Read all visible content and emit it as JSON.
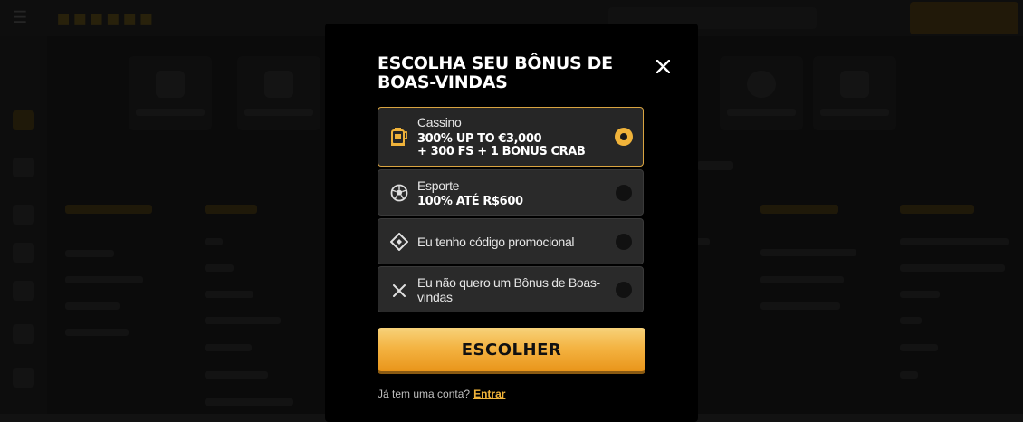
{
  "modal": {
    "title": "ESCOLHA SEU BÔNUS DE BOAS-VINDAS",
    "close_icon": "close-icon",
    "options": [
      {
        "label": "Cassino",
        "value_line1": "300% UP TO €3,000",
        "value_line2": "+ 300 FS + 1 BONUS CRAB",
        "icon": "slot-machine-icon",
        "selected": true
      },
      {
        "label": "Esporte",
        "value_line1": "100% ATÉ R$600",
        "icon": "soccer-ball-icon",
        "selected": false
      },
      {
        "text": "Eu tenho código promocional",
        "icon": "promo-tag-icon",
        "selected": false
      },
      {
        "text": "Eu não quero um Bônus de Boas-vindas",
        "icon": "close-icon",
        "selected": false
      }
    ],
    "choose_button": "ESCOLHER",
    "footer_question": "Já tem uma conta?",
    "footer_link": "Entrar"
  },
  "colors": {
    "accent": "#f0b33a",
    "modal_bg": "#000000",
    "option_bg": "#2a2a2a"
  }
}
